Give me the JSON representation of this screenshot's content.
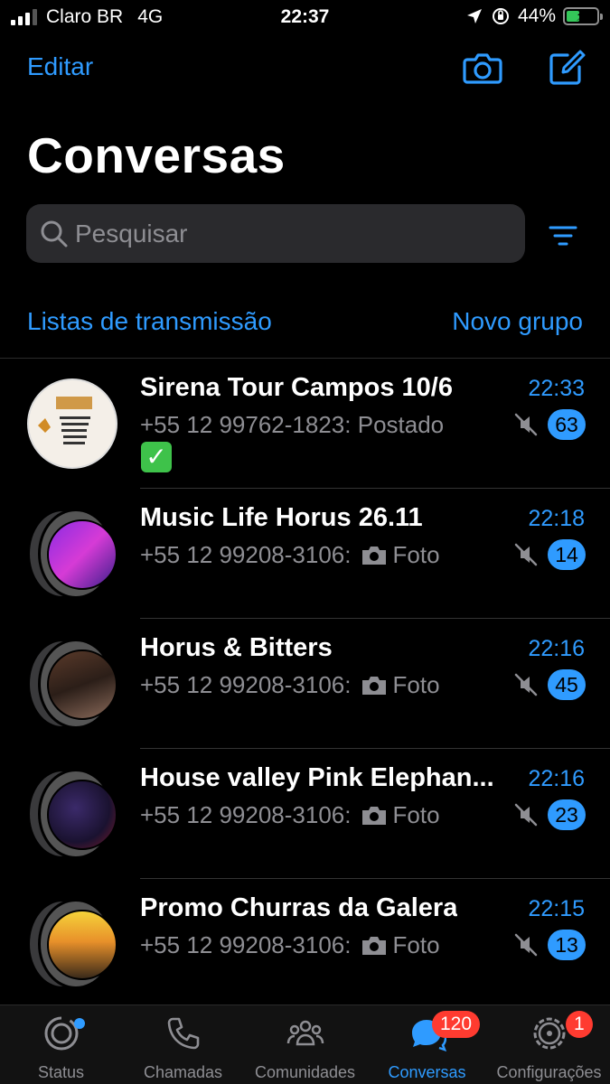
{
  "status_bar": {
    "carrier": "Claro BR",
    "network": "4G",
    "time": "22:37",
    "battery": "44%",
    "battery_level": 0.44
  },
  "header": {
    "edit_label": "Editar",
    "title": "Conversas",
    "camera_icon": "camera-icon",
    "compose_icon": "compose-icon"
  },
  "search": {
    "placeholder": "Pesquisar",
    "filter_icon": "filter-icon"
  },
  "links": {
    "broadcast": "Listas de transmissão",
    "new_group": "Novo grupo"
  },
  "chats": [
    {
      "name": "Sirena Tour Campos 10/6",
      "time": "22:33",
      "sender": "+55 12 99762-1823:",
      "message": "Postado",
      "extra": "✓",
      "unread": "63",
      "muted": true
    },
    {
      "name": "Music Life Horus 26.11",
      "time": "22:18",
      "sender": "+55 12 99208-3106:",
      "message": "Foto",
      "unread": "14",
      "muted": true
    },
    {
      "name": "Horus & Bitters",
      "time": "22:16",
      "sender": "+55 12 99208-3106:",
      "message": "Foto",
      "unread": "45",
      "muted": true
    },
    {
      "name": "House valley Pink Elephan...",
      "time": "22:16",
      "sender": "+55 12 99208-3106:",
      "message": "Foto",
      "unread": "23",
      "muted": true
    },
    {
      "name": "Promo Churras da Galera",
      "time": "22:15",
      "sender": "+55 12 99208-3106:",
      "message": "Foto",
      "unread": "13",
      "muted": true
    }
  ],
  "tabs": [
    {
      "label": "Status",
      "icon": "status-icon"
    },
    {
      "label": "Chamadas",
      "icon": "phone-icon"
    },
    {
      "label": "Comunidades",
      "icon": "communities-icon"
    },
    {
      "label": "Conversas",
      "icon": "chats-icon",
      "badge": "120",
      "active": true
    },
    {
      "label": "Configurações",
      "icon": "settings-icon",
      "badge": "1"
    }
  ],
  "colors": {
    "accent": "#2f9bff",
    "badge_red": "#ff3b30",
    "background": "#000000"
  }
}
